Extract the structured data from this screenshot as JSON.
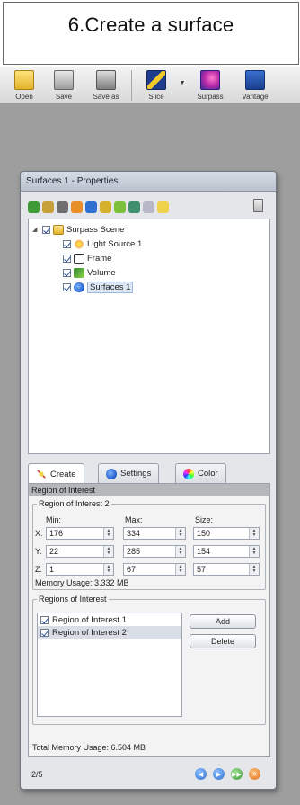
{
  "caption": {
    "text": "6.Create a surface"
  },
  "toolbar": {
    "buttons": [
      {
        "label": "Open",
        "icon": "folder-icon"
      },
      {
        "label": "Save",
        "icon": "save-icon"
      },
      {
        "label": "Save as",
        "icon": "save-as-icon"
      },
      {
        "label": "Slice",
        "icon": "slice-icon"
      },
      {
        "label": "Surpass",
        "icon": "surpass-icon"
      },
      {
        "label": "Vantage",
        "icon": "vantage-icon"
      }
    ]
  },
  "properties": {
    "title": "Surfaces 1 - Properties",
    "tree": {
      "root": "Surpass Scene",
      "children": [
        "Light Source 1",
        "Frame",
        "Volume",
        "Surfaces 1"
      ]
    },
    "tabs": [
      "Create",
      "Settings",
      "Color"
    ],
    "active_tab": "Create",
    "section_header": "Region of Interest",
    "roi_group_title": "Region of Interest 2",
    "columns": {
      "min": "Min:",
      "max": "Max:",
      "size": "Size:"
    },
    "rows": [
      {
        "label": "X:",
        "min": "176",
        "max": "334",
        "size": "150"
      },
      {
        "label": "Y:",
        "min": "22",
        "max": "285",
        "size": "154"
      },
      {
        "label": "Z:",
        "min": "1",
        "max": "67",
        "size": "57"
      }
    ],
    "memory_usage": "Memory Usage: 3.332 MB",
    "regions_group_title": "Regions of Interest",
    "regions": [
      "Region of Interest 1",
      "Region of Interest 2"
    ],
    "add_label": "Add",
    "delete_label": "Delete",
    "total_memory": "Total Memory Usage: 6.504 MB",
    "step": "2/5"
  },
  "colors": {
    "workspace": "#9e9e9e",
    "nav_back": "#3c7fd6",
    "nav_next": "#3c7fd6",
    "nav_ok": "#4aa84a",
    "nav_cancel": "#e07b22"
  }
}
